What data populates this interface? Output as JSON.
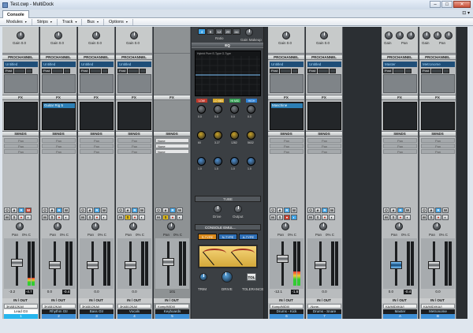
{
  "window": {
    "title": "Test.cwp - MultiDock"
  },
  "tab": {
    "label": "Console",
    "tools": "⊡ ▾"
  },
  "menus": [
    "Modules",
    "Strips",
    "Track",
    "Bus",
    "Options"
  ],
  "labels": {
    "gain": "Gain 0.0",
    "gain_short": "Gain",
    "pan_short": "Pan",
    "prochannel": "PROCHANNEL",
    "fx": "FX",
    "sends": "SENDS",
    "io": "IN / OUT",
    "post": "Post",
    "none": "None",
    "pan": "Pan",
    "pan_val": "0% C",
    "empty_send": "Pan",
    "master": "Master",
    "none_dash": "-None-"
  },
  "strips": [
    {
      "pc": "Untitled",
      "fx": "",
      "in": "3KAB12KA/I",
      "out": "Master",
      "v1": "-3.2",
      "v2": "-4.7",
      "name": "Lead Gtr",
      "num": "1",
      "cap": 0.52,
      "lvl": 0.18,
      "highlight": true,
      "write_active": true
    },
    {
      "pc": "Untitled",
      "fx": "Guitar Rig 5",
      "in": "3KAB12KA/I",
      "out": "Master",
      "v1": "0.0",
      "v2": "-0.4",
      "name": "Rhythm Gtr",
      "num": "2",
      "cap": 0.45,
      "lvl": 0.0
    },
    {
      "pc": "Untitled",
      "fx": "",
      "in": "3KAB12KA/I",
      "out": "Master",
      "v1": "0.0",
      "v2": "",
      "name": "Bass Gtr",
      "num": "3",
      "cap": 0.45,
      "lvl": 0.0
    },
    {
      "pc": "Untitled",
      "fx": "",
      "in": "3KAB12KA/I",
      "out": "Master",
      "v1": "0.0",
      "v2": "",
      "name": "Vocals",
      "num": "4",
      "cap": 0.45,
      "lvl": 0.0,
      "solo_yellow": true
    },
    {
      "pc": "",
      "fx": "",
      "in": "Komp/MIDI/I",
      "out": "Komp/MIDI/I",
      "v1": "101",
      "v2": "",
      "name": "Keyboards",
      "num": "5",
      "cap": 0.55,
      "lvl": 0.0,
      "midi": true,
      "solo_yellow": true
    },
    {
      "pc": "Untitled",
      "fx": "Maschine",
      "in": "Komp/MIDI/I",
      "out": "Master",
      "v1": "-12.1",
      "v2": "-1.6",
      "name": "Drums - Kick",
      "num": "6",
      "cap": 0.62,
      "lvl": 0.32,
      "rec_red": true
    },
    {
      "pc": "Untitled",
      "fx": "",
      "in": "-None-",
      "out": "Master",
      "v1": "0.0",
      "v2": "",
      "name": "Drums - Snare",
      "num": "7",
      "cap": 0.45,
      "lvl": 0.0
    },
    {
      "pc": "Master",
      "fx": "",
      "in": "KA/MIDI/KA/I",
      "out": "Master",
      "v1": "0.0",
      "v2": "-0.4",
      "name": "Master",
      "num": "A",
      "cap": 0.45,
      "lvl": 0.0,
      "bus": true,
      "blue_cap": true
    },
    {
      "pc": "Metronome",
      "fx": "",
      "in": "KA/MIDI/KA/I",
      "out": "Master",
      "v1": "0.0",
      "v2": "",
      "name": "Metronome",
      "num": "B",
      "cap": 0.45,
      "lvl": 0.0,
      "bus": true
    }
  ],
  "prochannel_panel": {
    "tabs": [
      "4",
      "8",
      "12",
      "20",
      "oo"
    ],
    "ratio": "Ratio",
    "makeup": "Gain Makeup",
    "eq_title": "EQ",
    "eq_modes": "Hybrid   Pure   E-Type   G-Type",
    "bands": [
      "LOW",
      "LO MID",
      "HI MID",
      "HIGH"
    ],
    "band_colors": [
      "#c0392b",
      "#d4a017",
      "#2e9e4f",
      "#2b7fd4"
    ],
    "gains": [
      "0.0",
      "0.0",
      "0.0",
      "0.0"
    ],
    "freqs": [
      "60",
      "3.27",
      "1282",
      "5632"
    ],
    "qs": [
      "1.0",
      "1.0",
      "1.0",
      "1.0"
    ],
    "tube": "TUBE",
    "tube_knobs": [
      "Drive",
      "Output"
    ],
    "console_emulator": "CONSOLE EMUL...",
    "types": [
      "S-TYPE",
      "N-TYPE",
      "A-TYPE"
    ],
    "type_colors": [
      "#d98a1c",
      "#2e6fb5",
      "#2e6fb5"
    ],
    "trim": "TRIM",
    "drive": "DRIVE",
    "tolerance": "TOLERANCE",
    "tol_btn": "TOL",
    "vu_scale_left": "-20  -10  -3  0  +3",
    "vu_scale_right": "-20  -10  -3  0  +3"
  }
}
